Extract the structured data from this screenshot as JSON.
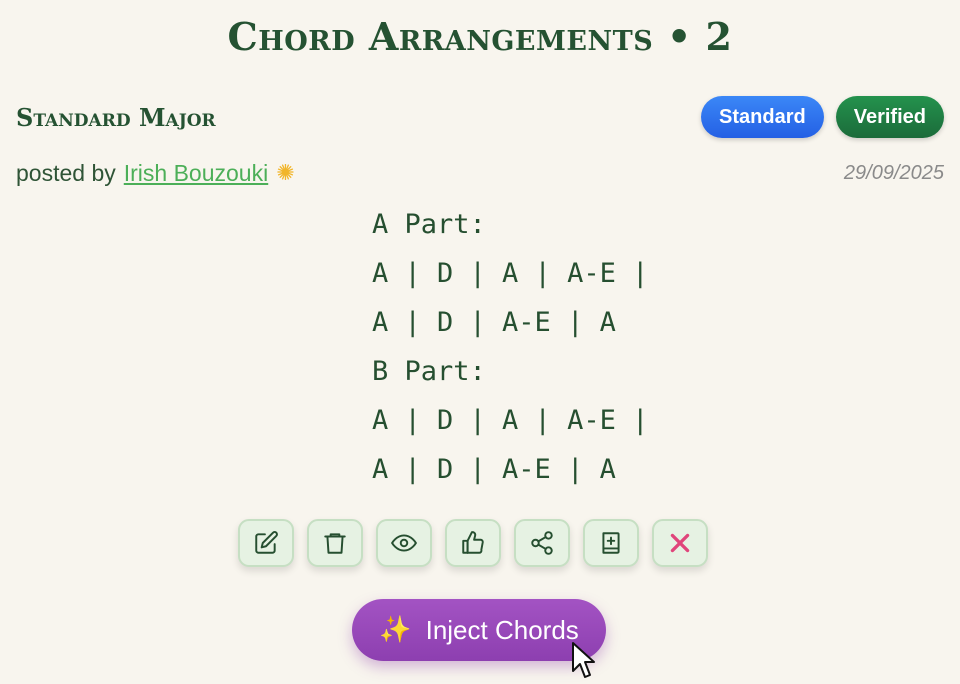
{
  "page": {
    "title": "Chord Arrangements • 2"
  },
  "arrangement": {
    "name": "Standard Major",
    "badges": {
      "standard": "Standard",
      "verified": "Verified"
    },
    "posted_prefix": "posted by",
    "author": "Irish Bouzouki",
    "author_icon": "sparkle-icon",
    "date": "29/09/2025",
    "lines": [
      "A Part:",
      "A | D | A | A-E |",
      "A | D | A-E | A",
      "B Part:",
      "A | D | A | A-E |",
      "A | D | A-E | A"
    ]
  },
  "actions": [
    {
      "name": "edit",
      "icon": "pencil-square-icon"
    },
    {
      "name": "delete",
      "icon": "trash-icon"
    },
    {
      "name": "view",
      "icon": "eye-icon"
    },
    {
      "name": "like",
      "icon": "thumbs-up-icon"
    },
    {
      "name": "share",
      "icon": "share-icon"
    },
    {
      "name": "add-to-book",
      "icon": "book-plus-icon"
    },
    {
      "name": "close",
      "icon": "close-icon"
    }
  ],
  "inject_button": {
    "label": "Inject Chords",
    "icon": "sparkles-icon"
  },
  "colors": {
    "background": "#f8f5ee",
    "heading": "#255232",
    "link": "#4caf58",
    "badge_standard": "#2f73ef",
    "badge_verified": "#1f7f43",
    "inject": "#9749b9",
    "close_x": "#e0457b"
  }
}
